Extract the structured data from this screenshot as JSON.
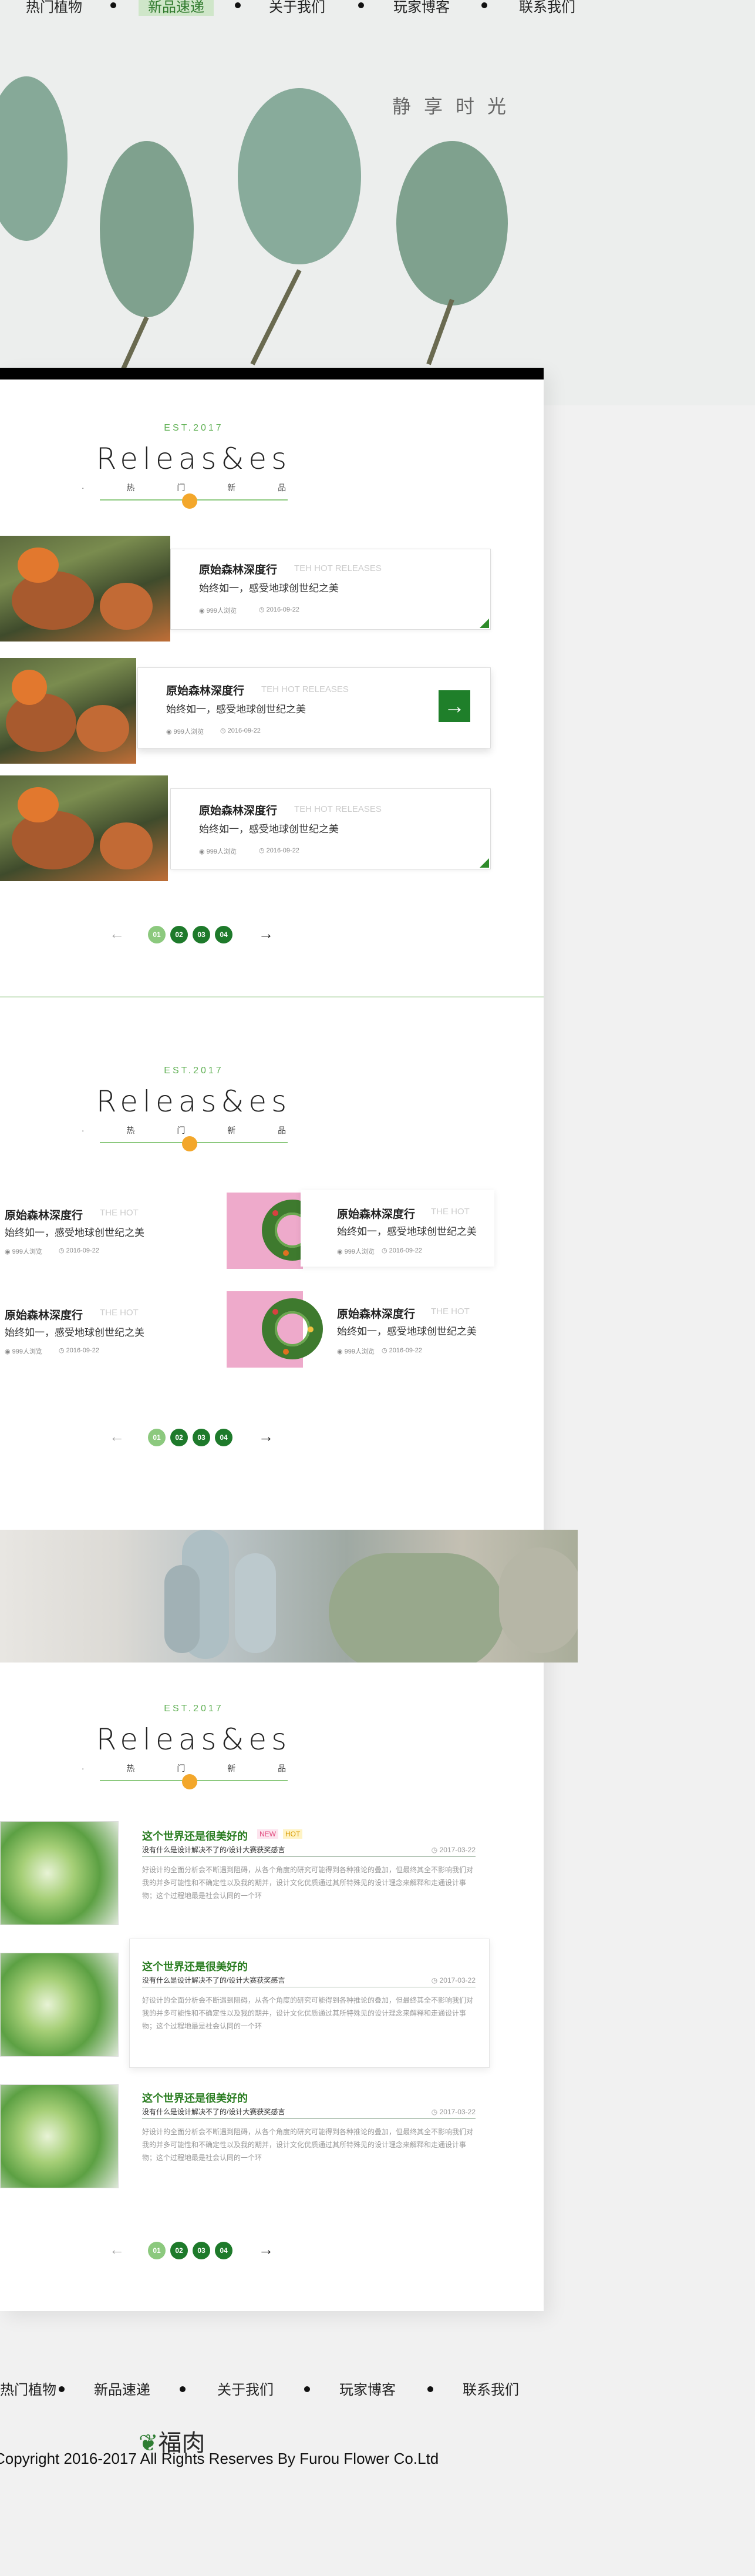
{
  "nav": {
    "items": [
      {
        "label": "热门植物"
      },
      {
        "label": "新品速递",
        "active": true
      },
      {
        "label": "关于我们"
      },
      {
        "label": "玩家博客"
      },
      {
        "label": "联系我们"
      }
    ]
  },
  "hero": {
    "title": "静享时光"
  },
  "heading": {
    "est": "EST.2017",
    "title": "Releas&es",
    "subtitle": "· 热 门 新 品 ·"
  },
  "section1": {
    "cards": [
      {
        "title": "原始森林深度行",
        "en": "TEH HOT RELEASES",
        "desc": "始终如一，感受地球创世纪之美",
        "views": "999人浏览",
        "date": "2016-09-22"
      },
      {
        "title": "原始森林深度行",
        "en": "TEH HOT RELEASES",
        "desc": "始终如一，感受地球创世纪之美",
        "views": "999人浏览",
        "date": "2016-09-22"
      },
      {
        "title": "原始森林深度行",
        "en": "TEH HOT RELEASES",
        "desc": "始终如一，感受地球创世纪之美",
        "views": "999人浏览",
        "date": "2016-09-22"
      }
    ]
  },
  "pager": {
    "pages": [
      "01",
      "02",
      "03",
      "04"
    ],
    "prev": "←",
    "next": "→"
  },
  "section2": {
    "cells": [
      {
        "title": "原始森林深度行",
        "en": "THE HOT",
        "desc": "始终如一，感受地球创世纪之美",
        "views": "999人浏览",
        "date": "2016-09-22"
      },
      {
        "title": "原始森林深度行",
        "en": "THE HOT",
        "desc": "始终如一，感受地球创世纪之美",
        "views": "999人浏览",
        "date": "2016-09-22"
      },
      {
        "title": "原始森林深度行",
        "en": "THE HOT",
        "desc": "始终如一，感受地球创世纪之美",
        "views": "999人浏览",
        "date": "2016-09-22"
      },
      {
        "title": "原始森林深度行",
        "en": "THE HOT",
        "desc": "始终如一，感受地球创世纪之美",
        "views": "999人浏览",
        "date": "2016-09-22"
      }
    ]
  },
  "section3": {
    "articles": [
      {
        "title": "这个世界还是很美好的",
        "badge_new": "NEW",
        "badge_hot": "HOT",
        "sub": "没有什么是设计解决不了的/设计大赛获奖感言",
        "date": "2017-03-22",
        "body": "好设计的全面分析会不断遇到阻碍，从各个角度的研究可能得到各种推论的叠加，但最终其全不影响我们对我的并多可能性和不确定性以及我的期并，设计文化优质通过其所特殊见的设计理念来解释和走通设计事物；这个过程地最是社会认同的一个环"
      },
      {
        "title": "这个世界还是很美好的",
        "badge_new": "",
        "badge_hot": "",
        "sub": "没有什么是设计解决不了的/设计大赛获奖感言",
        "date": "2017-03-22",
        "body": "好设计的全面分析会不断遇到阻碍，从各个角度的研究可能得到各种推论的叠加，但最终其全不影响我们对我的并多可能性和不确定性以及我的期并，设计文化优质通过其所特殊见的设计理念来解释和走通设计事物；这个过程地最是社会认同的一个环"
      },
      {
        "title": "这个世界还是很美好的",
        "badge_new": "",
        "badge_hot": "",
        "sub": "没有什么是设计解决不了的/设计大赛获奖感言",
        "date": "2017-03-22",
        "body": "好设计的全面分析会不断遇到阻碍，从各个角度的研究可能得到各种推论的叠加，但最终其全不影响我们对我的并多可能性和不确定性以及我的期并，设计文化优质通过其所特殊见的设计理念来解释和走通设计事物；这个过程地最是社会认同的一个环"
      }
    ]
  },
  "footer": {
    "nav": [
      {
        "label": "热门植物"
      },
      {
        "label": "新品速递"
      },
      {
        "label": "关于我们"
      },
      {
        "label": "玩家博客"
      },
      {
        "label": "联系我们"
      }
    ],
    "logo": "福肉",
    "copyright": "Copyright 2016-2017 All Rights Reserves By Furou Flower Co.Ltd"
  },
  "colors": {
    "accent": "#1e7a2b",
    "accent_light": "#8cc97e",
    "orange": "#f3a72b",
    "pink": "#eeaacb"
  }
}
